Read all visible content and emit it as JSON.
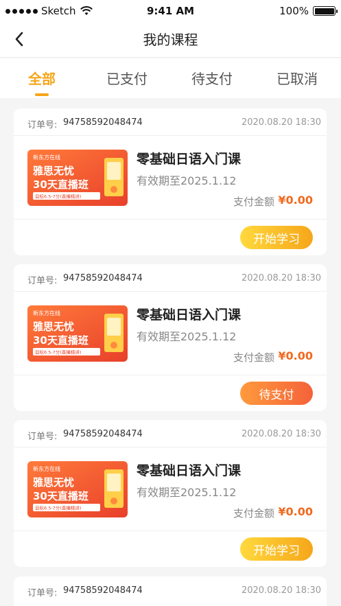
{
  "status_bar": {
    "carrier": "Sketch",
    "time": "9:41 AM",
    "battery": "100%"
  },
  "nav": {
    "title": "我的课程"
  },
  "tabs": [
    {
      "label": "全部",
      "active": true
    },
    {
      "label": "已支付",
      "active": false
    },
    {
      "label": "待支付",
      "active": false
    },
    {
      "label": "已取消",
      "active": false
    }
  ],
  "colors": {
    "accent": "#f6a61a",
    "price": "#f06a1f",
    "pay_button": "#f4623a"
  },
  "order_label": "订单号:",
  "pay_amount_label": "支付金额",
  "thumb": {
    "brand": "新东方在线",
    "line1": "雅思无忧",
    "line2": "30天直播班",
    "sub": "目标6.5-7分(直播精讲)"
  },
  "orders": [
    {
      "order_no": "94758592048474",
      "date": "2020.08.20 18:30",
      "course": "零基础日语入门课",
      "valid": "有效期至2025.1.12",
      "price": "¥0.00",
      "action": "开始学习"
    },
    {
      "order_no": "94758592048474",
      "date": "2020.08.20 18:30",
      "course": "零基础日语入门课",
      "valid": "有效期至2025.1.12",
      "price": "¥0.00",
      "action": "待支付"
    },
    {
      "order_no": "94758592048474",
      "date": "2020.08.20 18:30",
      "course": "零基础日语入门课",
      "valid": "有效期至2025.1.12",
      "price": "¥0.00",
      "action": "开始学习"
    },
    {
      "order_no": "94758592048474",
      "date": "2020.08.20 18:30"
    }
  ]
}
